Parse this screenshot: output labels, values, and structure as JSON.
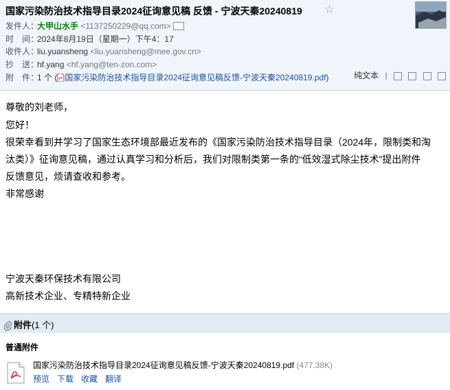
{
  "header": {
    "subject": "国家污染防治技术指导目录2024征询意见稿 反馈 - 宁波天秦20240819",
    "star_icon": "star-outline-icon",
    "sender_label": "发件人：",
    "sender_name": "大甲山水手",
    "sender_email": "<1137250229@qq.com>",
    "time_label": "时　间：",
    "time_value": "2024年8月19日（星期一）下午4：17",
    "to_label": "收件人：",
    "to_name": "liu.yuansheng",
    "to_email": "<liu.yuansheng@mee.gov.cn>",
    "cc_label": "抄　送：",
    "cc_name": "hf.yang",
    "cc_email": "<hf.yang@ten-zon.com>",
    "attach_label": "附　件：",
    "attach_count": "1 个 (",
    "attach_file": "国家污染防治技术指导目录2024征询意见稿反馈-宁波天秦20240819.pdf",
    "attach_close": ")",
    "plain_text": "纯文本"
  },
  "body": {
    "greeting": "尊敬的刘老师，",
    "hello": "您好！",
    "para1": "很荣幸看到并学习了国家生态环境部最近发布的《国家污染防治技术指导目录（2024年，限制类和淘",
    "para2": "汰类）》征询意见稿，通过认真学习和分析后，我们对限制类第一条的“低效湿式除尘技术”提出附件",
    "para3": "反馈意见，烦请查收和参考。",
    "thanks": "非常感谢",
    "company": "宁波天秦环保技术有限公司",
    "tagline": "高新技术企业、专精特新企业"
  },
  "attachments": {
    "bar_title": "附件",
    "bar_count": "(1 个)",
    "section_label": "普通附件",
    "file_name": "国家污染防治技术指导目录2024征询意见稿反馈-宁波天秦20240819.pdf",
    "file_size": "(477.38K)",
    "actions": [
      "预览",
      "下载",
      "收藏",
      "翻译"
    ]
  },
  "colors": {
    "header_bg": "#f0f5fb",
    "attach_bar_bg": "#e2ebf5",
    "sender_green": "#108010",
    "link_blue": "#1e50a2",
    "pdf_red": "#d32f2f"
  }
}
